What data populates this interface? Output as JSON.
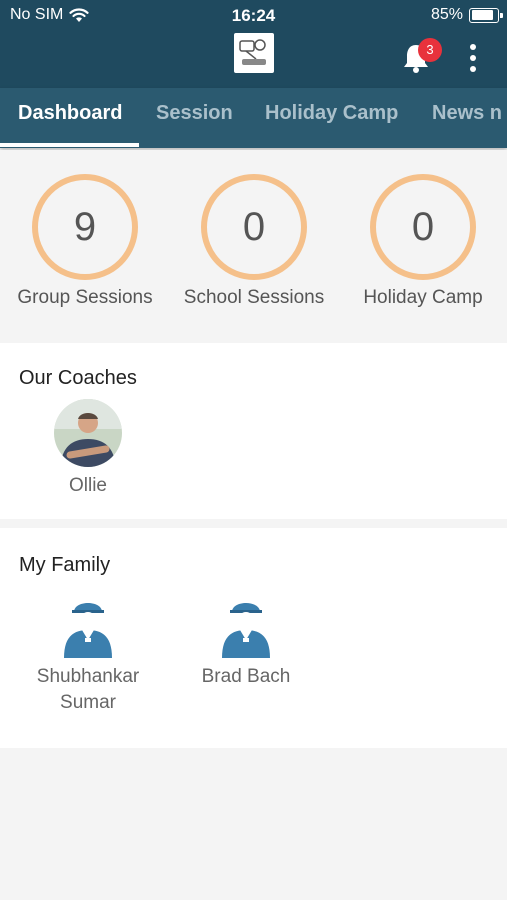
{
  "status_bar": {
    "carrier": "No SIM",
    "time": "16:24",
    "battery": "85%",
    "battery_level": 0.85
  },
  "header": {
    "notification_count": "3"
  },
  "tabs": [
    {
      "label": "Dashboard",
      "active": true
    },
    {
      "label": "Session"
    },
    {
      "label": "Holiday Camp"
    },
    {
      "label": "News n"
    }
  ],
  "stats": [
    {
      "value": "9",
      "label": "Group Sessions"
    },
    {
      "value": "0",
      "label": "School Sessions"
    },
    {
      "value": "0",
      "label": "Holiday Camp"
    }
  ],
  "coaches": {
    "title": "Our Coaches",
    "items": [
      {
        "name": "Ollie"
      }
    ]
  },
  "family": {
    "title": "My Family",
    "items": [
      {
        "name": "Shubhankar Sumar"
      },
      {
        "name": "Brad Bach"
      }
    ]
  },
  "colors": {
    "header": "#1f4a5f",
    "tabs": "#2b5a70",
    "ring": "#f5c08a",
    "badge": "#e8323c",
    "person_icon": "#3b7fae"
  }
}
